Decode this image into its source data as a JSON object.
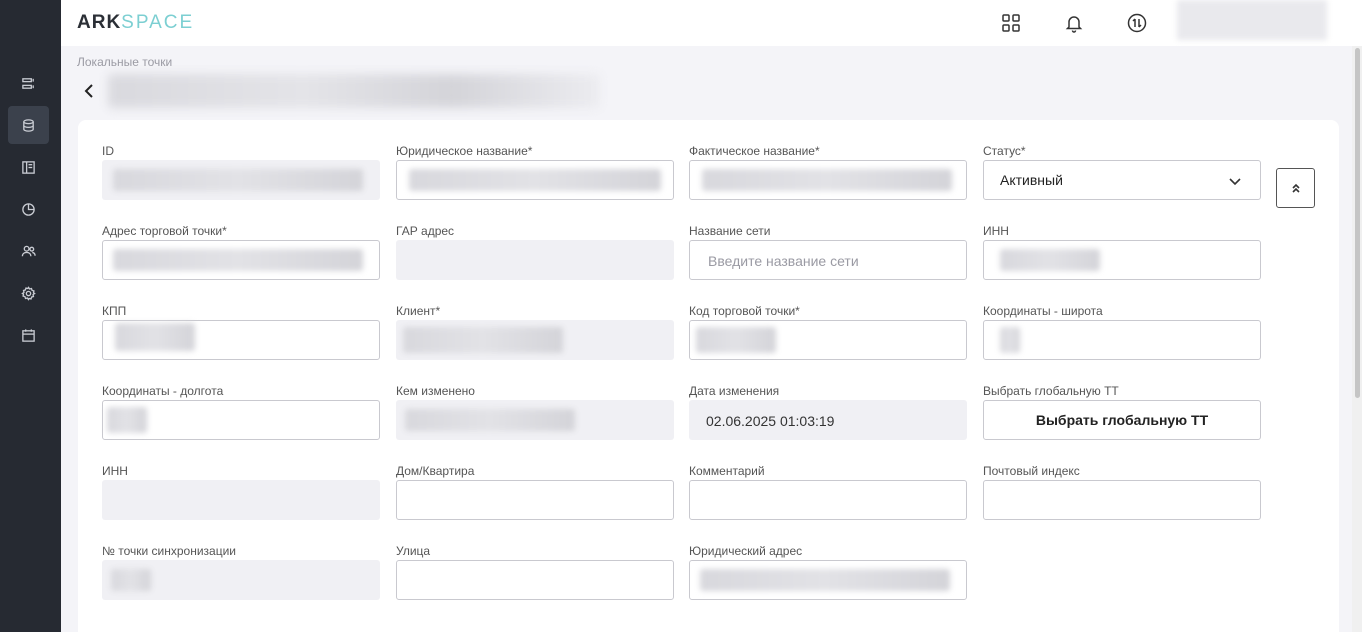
{
  "header": {
    "logo_part1": "ARK",
    "logo_part2": "SPACE",
    "icons": [
      "grid-icon",
      "bell-icon",
      "sync-icon"
    ]
  },
  "sidebar": {
    "items": [
      {
        "icon": "list-icon"
      },
      {
        "icon": "database-icon",
        "active": true
      },
      {
        "icon": "layout-icon"
      },
      {
        "icon": "chart-pie-icon"
      },
      {
        "icon": "users-icon"
      },
      {
        "icon": "gear-icon"
      },
      {
        "icon": "calendar-icon"
      }
    ]
  },
  "breadcrumb": "Локальные точки",
  "form": {
    "id_label": "ID",
    "legal_name_label": "Юридическое название*",
    "actual_name_label": "Фактическое название*",
    "status_label": "Статус*",
    "status_value": "Активный",
    "address_label": "Адрес торговой точки*",
    "gar_label": "ГАР адрес",
    "network_label": "Название сети",
    "network_placeholder": "Введите название сети",
    "inn_label": "ИНН",
    "kpp_label": "КПП",
    "client_label": "Клиент*",
    "outlet_code_label": "Код торговой точки*",
    "lat_label": "Координаты - широта",
    "lon_label": "Координаты - долгота",
    "changed_by_label": "Кем изменено",
    "changed_date_label": "Дата изменения",
    "changed_date_value": "02.06.2025 01:03:19",
    "global_tt_label": "Выбрать глобальную ТТ",
    "global_tt_button": "Выбрать глобальную ТТ",
    "inn2_label": "ИНН",
    "house_label": "Дом/Квартира",
    "comment_label": "Комментарий",
    "postal_label": "Почтовый индекс",
    "sync_label": "№ точки синхронизации",
    "street_label": "Улица",
    "legal_address_label": "Юридический адрес"
  }
}
